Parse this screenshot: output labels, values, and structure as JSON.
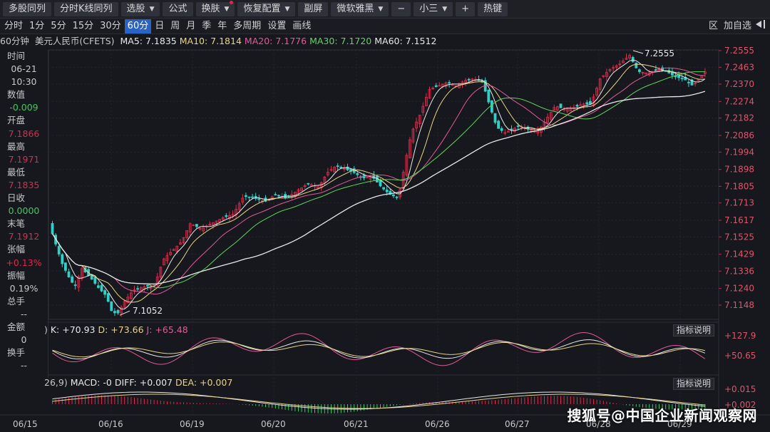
{
  "toolbar": {
    "items": [
      {
        "label": "多股同列",
        "caret": false
      },
      {
        "label": "分时K线同列",
        "caret": false
      },
      {
        "label": "选股",
        "caret": true
      },
      {
        "label": "公式",
        "caret": false
      },
      {
        "label": "换肤",
        "caret": true,
        "dot": true
      },
      {
        "label": "恢复配置",
        "caret": true
      },
      {
        "label": "副屏",
        "caret": false
      },
      {
        "label": "微软雅黑",
        "caret": true
      },
      {
        "label": "−",
        "caret": false
      },
      {
        "label": "小三",
        "caret": true
      },
      {
        "label": "+",
        "caret": false
      },
      {
        "label": "热键",
        "caret": false
      }
    ]
  },
  "periods": [
    "分时",
    "1分",
    "5分",
    "15分",
    "30分",
    "60分",
    "日",
    "周",
    "月",
    "季",
    "年",
    "多周期",
    "设置",
    "画线"
  ],
  "active_period": "60分",
  "right_tools": {
    "range": "区",
    "fuquan": "加自选"
  },
  "ma_bar": {
    "period": "60分钟",
    "name": "美元人民币(CFETS)",
    "items": [
      {
        "label": "MA5: 7.1835",
        "color": "#e8e8e8"
      },
      {
        "label": "MA10: 7.1814",
        "color": "#e8d48a"
      },
      {
        "label": "MA20: 7.1776",
        "color": "#e05a9a"
      },
      {
        "label": "MA30: 7.1720",
        "color": "#5ed65e"
      },
      {
        "label": "MA60: 7.1512",
        "color": "#e8e8e8"
      }
    ]
  },
  "left_info": [
    {
      "label": "时间",
      "color": "#c8c8c8"
    },
    {
      "label": "06-21",
      "color": "#c8c8c8",
      "val": true
    },
    {
      "label": "10:30",
      "color": "#c8c8c8",
      "val": true
    },
    {
      "label": "数值",
      "color": "#c8c8c8"
    },
    {
      "label": "-0.009",
      "color": "#2fd05c",
      "val": true
    },
    {
      "label": "开盘",
      "color": "#c8c8c8"
    },
    {
      "label": "7.1866",
      "color": "#e0294a",
      "val": true
    },
    {
      "label": "最高",
      "color": "#c8c8c8"
    },
    {
      "label": "7.1971",
      "color": "#e0294a",
      "val": true
    },
    {
      "label": "最低",
      "color": "#c8c8c8"
    },
    {
      "label": "7.1835",
      "color": "#e0294a",
      "val": true
    },
    {
      "label": "日收",
      "color": "#c8c8c8"
    },
    {
      "label": "0.0000",
      "color": "#2fd05c",
      "val": true
    },
    {
      "label": "末笔",
      "color": "#c8c8c8"
    },
    {
      "label": "7.1912",
      "color": "#e0294a",
      "val": true
    },
    {
      "label": "张幅",
      "color": "#c8c8c8"
    },
    {
      "label": "+0.13%",
      "color": "#e0294a",
      "val": true
    },
    {
      "label": "振幅",
      "color": "#c8c8c8"
    },
    {
      "label": "0.19%",
      "color": "#c8c8c8",
      "val": true
    },
    {
      "label": "总手",
      "color": "#c8c8c8"
    },
    {
      "label": "--",
      "color": "#c8c8c8",
      "val": true
    },
    {
      "label": "金额",
      "color": "#c8c8c8"
    },
    {
      "label": "0",
      "color": "#c8c8c8",
      "val": true
    },
    {
      "label": "换手",
      "color": "#c8c8c8"
    },
    {
      "label": "--",
      "color": "#c8c8c8",
      "val": true
    }
  ],
  "price_axis": [
    "7.2555",
    "7.2463",
    "7.2370",
    "7.2274",
    "7.2182",
    "7.2086",
    "7.1994",
    "7.1898",
    "7.1805",
    "7.1713",
    "7.1617",
    "7.1525",
    "7.1429",
    "7.1336",
    "7.1240",
    "7.1148"
  ],
  "high_label": "7.2555",
  "low_label": "7.1052",
  "kdj": {
    "k": "K: +70.93",
    "d": "D: +73.66",
    "j": "J: +65.48",
    "axis_top": "+127.9",
    "axis_mid": "+50.65"
  },
  "macd": {
    "prefix": "26,9)",
    "name": "MACD: -0",
    "diff": "DIFF: +0.007",
    "dea": "DEA: +0.007",
    "axis_top": "+0.015",
    "axis_bot": "+0.002"
  },
  "indicator_btn": "指标说明",
  "dates": [
    "06/15",
    "06/16",
    "06/19",
    "06/20",
    "06/21",
    "06/26",
    "06/27",
    "06/28",
    "06/29"
  ],
  "watermark": "搜狐号@中国企业新闻观察网",
  "colors": {
    "up": "#e0294a",
    "down": "#2fd0c8",
    "bg": "#16181d"
  }
}
